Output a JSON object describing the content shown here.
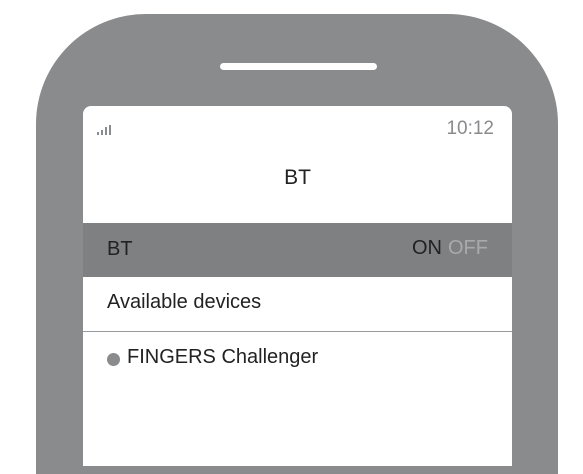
{
  "status_bar": {
    "signal_icon": "signal-bars-icon",
    "time": "10:12"
  },
  "screen": {
    "title": "BT"
  },
  "bluetooth_row": {
    "label": "BT",
    "on_label": "ON",
    "off_label": "OFF",
    "state": "on"
  },
  "devices_section": {
    "header": "Available devices",
    "items": [
      {
        "name": "FINGERS Challenger",
        "icon": "device-dot-icon"
      }
    ]
  },
  "colors": {
    "phone_body": "#8a8b8d",
    "bt_row_background": "#7f8082",
    "off_text": "#a9aaac"
  }
}
